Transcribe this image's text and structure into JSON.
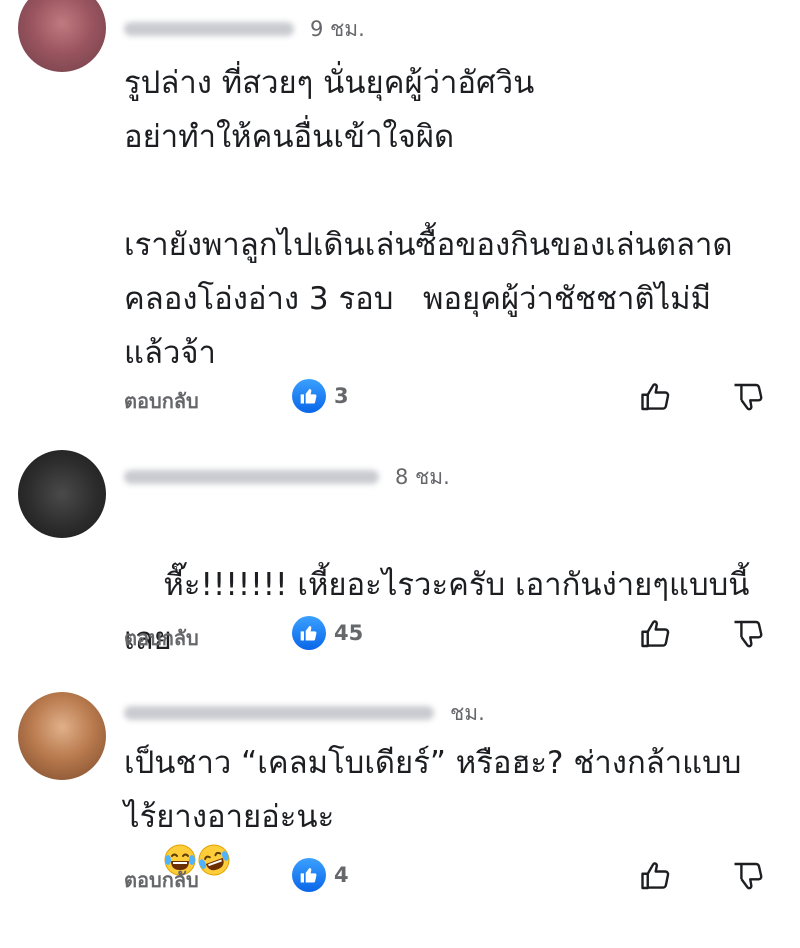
{
  "comments": [
    {
      "time": "9 ชม.",
      "text": "รูปล่าง ที่สวยๆ นั่นยุคผู้ว่าอัศวิน\nอย่าทำให้คนอื่นเข้าใจผิด\n\nเรายังพาลูกไปเดินเล่นซื้อของกินของเล่นตลาด\nคลองโอ่งอ่าง 3 รอบ   พอยุคผู้ว่าชัชชาติไม่มี\nแล้วจ้า",
      "reply_label": "ตอบกลับ",
      "like_count": "3"
    },
    {
      "time": "8 ชม.",
      "text": "หื๊ะ!!!!!!! เหี้ยอะไรวะครับ เอากันง่ายๆแบบนี้เลย",
      "reply_label": "ตอบกลับ",
      "like_count": "45"
    },
    {
      "time": "ชม.",
      "text": "เป็นชาว “เคลมโบเดียร์” หรือฮะ? ช่างกล้าแบบ\nไร้ยางอายอ่ะนะ",
      "reply_label": "ตอบกลับ",
      "like_count": "4"
    }
  ],
  "icons": {
    "like_badge": "thumbs-up-icon",
    "upvote": "thumb-up-outline-icon",
    "downvote": "thumb-down-outline-icon",
    "laugh_emoji": "laughing-tears-emoji"
  },
  "colors": {
    "accent": "#0a66e8",
    "secondary_text": "#65676b",
    "primary_text": "#1c1e21"
  }
}
